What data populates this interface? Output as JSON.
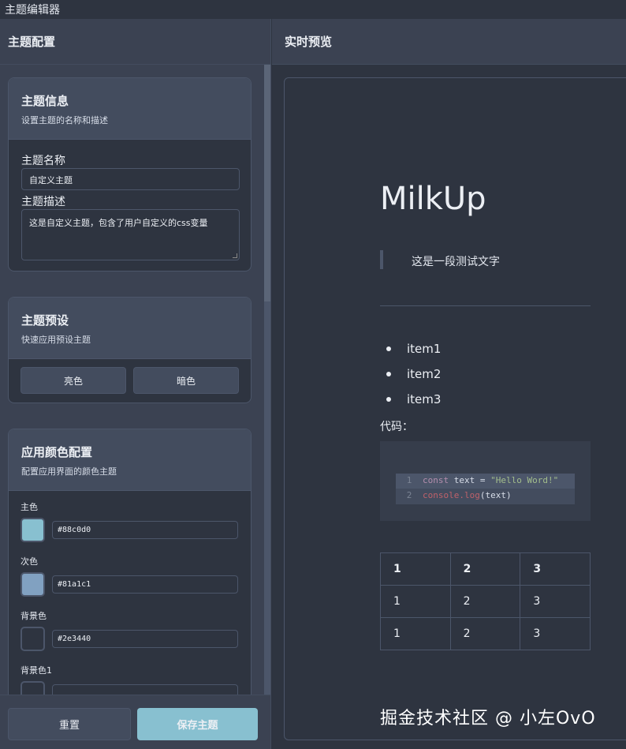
{
  "window": {
    "title": "主题编辑器"
  },
  "left_panel": {
    "title": "主题配置"
  },
  "theme_info": {
    "title": "主题信息",
    "subtitle": "设置主题的名称和描述",
    "name_label": "主题名称",
    "name_value": "自定义主题",
    "desc_label": "主题描述",
    "desc_value": "这是自定义主题，包含了用户自定义的css变量"
  },
  "presets": {
    "title": "主题预设",
    "subtitle": "快速应用预设主题",
    "light_label": "亮色",
    "dark_label": "暗色"
  },
  "app_colors": {
    "title": "应用颜色配置",
    "subtitle": "配置应用界面的颜色主题",
    "items": [
      {
        "label": "主色",
        "value": "#88c0d0",
        "color": "#88c0d0"
      },
      {
        "label": "次色",
        "value": "#81a1c1",
        "color": "#81a1c1"
      },
      {
        "label": "背景色",
        "value": "#2e3440",
        "color": "#2e3440"
      },
      {
        "label": "背景色1",
        "value": "",
        "color": "#2e3440"
      }
    ]
  },
  "footer": {
    "reset_label": "重置",
    "save_label": "保存主题"
  },
  "right_panel": {
    "title": "实时预览"
  },
  "preview": {
    "heading": "MilkUp",
    "quote": "这是一段测试文字",
    "list": [
      "item1",
      "item2",
      "item3"
    ],
    "code_label": "代码：",
    "code": {
      "line1": {
        "num": "1",
        "kw": "const",
        "var": " text = ",
        "str": "\"Hello Word!\""
      },
      "line2": {
        "num": "2",
        "fn": "console.log",
        "rest": "(text)"
      }
    },
    "table": [
      [
        "1",
        "2",
        "3"
      ],
      [
        "1",
        "2",
        "3"
      ],
      [
        "1",
        "2",
        "3"
      ]
    ]
  },
  "watermark": "掘金技术社区 @ 小左OvO"
}
